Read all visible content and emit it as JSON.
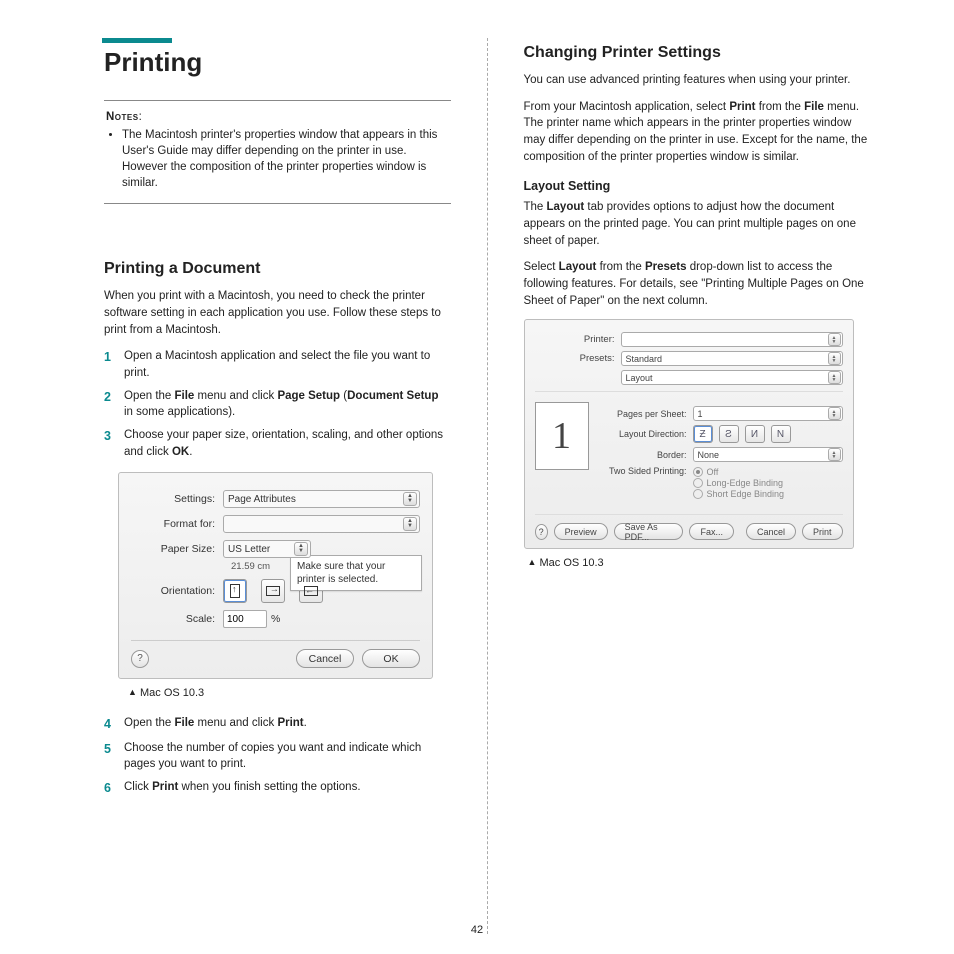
{
  "page_number": "42",
  "left": {
    "title": "Printing",
    "notes_label": "Notes",
    "notes_colon": ":",
    "notes_item": "The Macintosh printer's properties window that appears in this User's Guide may differ depending on the printer in use. However the composition of the printer properties window is similar.",
    "subheading": "Printing a Document",
    "intro": "When you print with a Macintosh, you need to check the printer software setting in each application you use. Follow these steps to print from a Macintosh.",
    "steps1": [
      "Open a Macintosh application and select the file you want to print.",
      "Open the <b>File</b> menu and click <b>Page Setup</b> (<b>Document Setup</b> in some applications).",
      "Choose your paper size, orientation, scaling, and other options and click <b>OK</b>."
    ],
    "dialog": {
      "settings_label": "Settings:",
      "settings_value": "Page Attributes",
      "format_label": "Format for:",
      "format_value": "",
      "paper_label": "Paper Size:",
      "paper_value": "US Letter",
      "paper_sub": "21.59 cm",
      "orientation_label": "Orientation:",
      "scale_label": "Scale:",
      "scale_value": "100",
      "scale_unit": "%",
      "callout": "Make sure that your printer is selected.",
      "help": "?",
      "cancel": "Cancel",
      "ok": "OK"
    },
    "caption1": "Mac OS 10.3",
    "steps2": [
      "Open the <b>File</b> menu and click <b>Print</b>.",
      "Choose the number of copies you want and indicate which pages you want to print.",
      "Click <b>Print</b> when you finish setting the options."
    ]
  },
  "right": {
    "heading": "Changing Printer Settings",
    "p1": "You can use advanced printing features when using your printer.",
    "p2": "From your Macintosh application, select <b>Print</b> from the <b>File</b> menu. The printer name which appears in the printer properties window may differ depending on the printer in use. Except for the name, the composition of the printer properties window is similar.",
    "sub": "Layout Setting",
    "p3": "The <b>Layout</b> tab provides options to adjust how the document appears on the printed page. You can print multiple pages on one sheet of paper.",
    "p4": "Select <b>Layout</b> from the <b>Presets</b> drop-down list to access the following features. For details, see \"Printing Multiple Pages on One Sheet of Paper\" on the next column.",
    "dialog": {
      "printer_label": "Printer:",
      "printer_value": "",
      "presets_label": "Presets:",
      "presets_value": "Standard",
      "pane_value": "Layout",
      "pages_label": "Pages per Sheet:",
      "pages_value": "1",
      "dir_label": "Layout Direction:",
      "border_label": "Border:",
      "border_value": "None",
      "twosided_label": "Two Sided Printing:",
      "ts_off": "Off",
      "ts_long": "Long-Edge Binding",
      "ts_short": "Short Edge Binding",
      "preview_num": "1",
      "help": "?",
      "preview_btn": "Preview",
      "saveas": "Save As PDF...",
      "fax": "Fax...",
      "cancel": "Cancel",
      "print": "Print"
    },
    "caption": "Mac OS 10.3"
  }
}
